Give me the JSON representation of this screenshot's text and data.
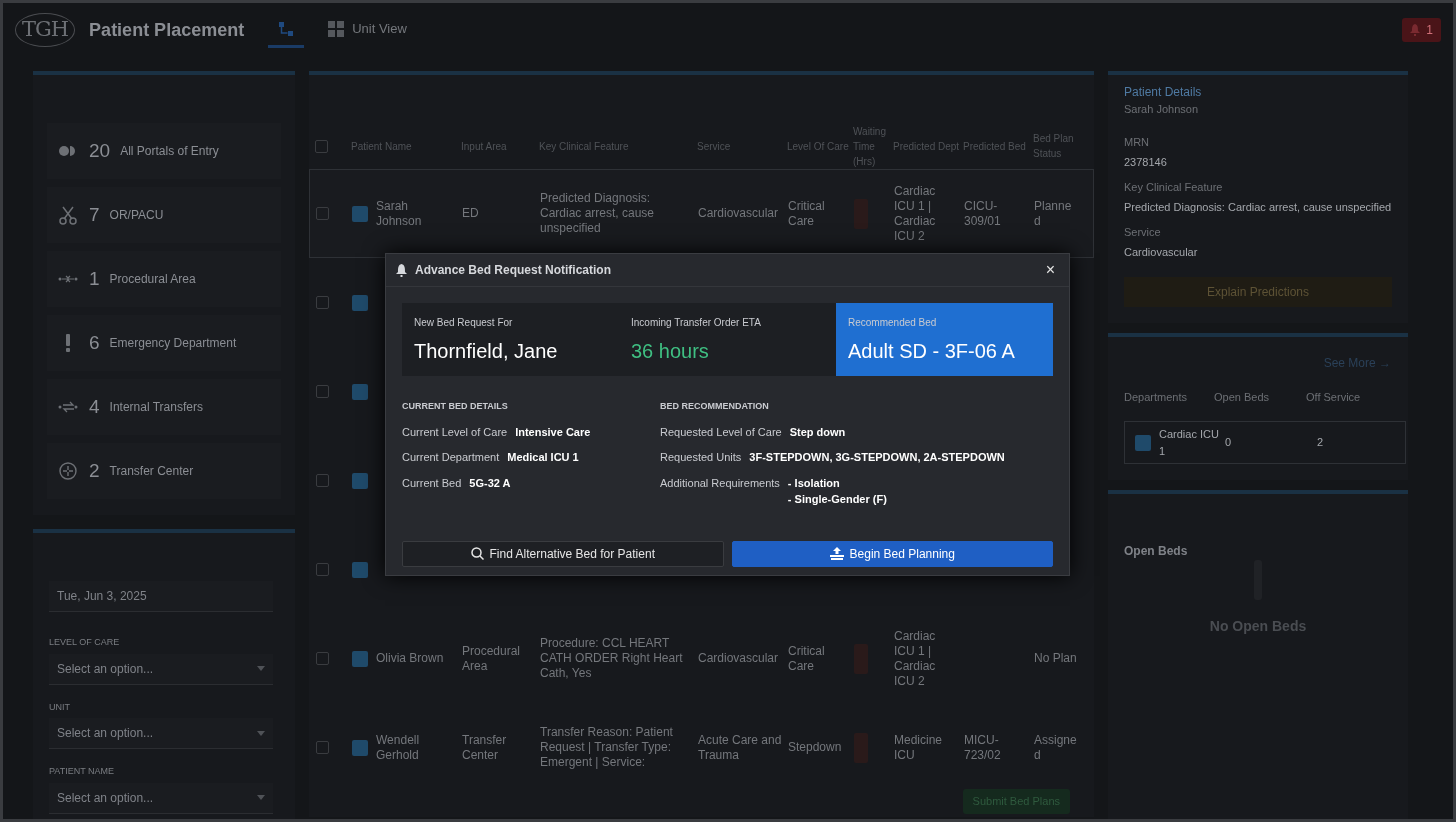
{
  "app": {
    "logo": "TGH",
    "title": "Patient Placement"
  },
  "nav_tabs": [
    {
      "selected": true
    },
    {
      "label": "Unit View",
      "selected": false
    }
  ],
  "notifications": {
    "count": "1"
  },
  "portals": [
    {
      "kind": "toggle",
      "count": "20",
      "label": "All Portals of Entry"
    },
    {
      "kind": "scissors",
      "count": "7",
      "label": "OR/PACU"
    },
    {
      "kind": "procedure",
      "count": "1",
      "label": "Procedural Area"
    },
    {
      "kind": "alert",
      "count": "6",
      "label": "Emergency Department"
    },
    {
      "kind": "transfer",
      "count": "4",
      "label": "Internal Transfers"
    },
    {
      "kind": "target",
      "count": "2",
      "label": "Transfer Center"
    }
  ],
  "filters": {
    "date": "Tue, Jun 3, 2025",
    "selects": [
      {
        "label": "LEVEL OF CARE",
        "placeholder": "Select an option..."
      },
      {
        "label": "UNIT",
        "placeholder": "Select an option..."
      },
      {
        "label": "PATIENT NAME",
        "placeholder": "Select an option..."
      }
    ]
  },
  "table": {
    "header_checked": false,
    "columns": [
      "Patient Name",
      "Input Area",
      "Key Clinical Feature",
      "Service",
      "Level Of Care",
      "Waiting Time (Hrs)",
      "Predicted Dept",
      "Predicted Bed",
      "Bed Plan Status"
    ],
    "rows": [
      {
        "kind": "full",
        "selected": true,
        "checked": false,
        "name": "Sarah Johnson",
        "input_area": "ED",
        "feature": "Predicted Diagnosis: Cardiac arrest, cause unspecified",
        "service": "Cardiovascular",
        "level_of_care": "Critical Care",
        "dept": "Cardiac ICU 1 | Cardiac ICU 2",
        "bed": "CICU-309/01",
        "status": "Planned"
      },
      {
        "kind": "covered",
        "selected": false,
        "checked": false
      },
      {
        "kind": "covered",
        "selected": false,
        "checked": false
      },
      {
        "kind": "covered",
        "selected": false,
        "checked": false
      },
      {
        "kind": "covered",
        "selected": false,
        "checked": false
      },
      {
        "kind": "full",
        "selected": false,
        "checked": false,
        "name": "Olivia Brown",
        "input_area": "Procedural Area",
        "feature": "Procedure: CCL HEART CATH ORDER Right Heart Cath, Yes",
        "service": "Cardiovascular",
        "level_of_care": "Critical Care",
        "dept": "Cardiac ICU 1 | Cardiac ICU 2",
        "status": "No Plan"
      },
      {
        "kind": "full",
        "selected": false,
        "checked": false,
        "name": "Wendell Gerhold",
        "input_area": "Transfer Center",
        "feature": "Transfer Reason: Patient Request | Transfer Type: Emergent | Service:",
        "service": "Acute Care and Trauma",
        "level_of_care": "Stepdown",
        "dept": "Medicine ICU",
        "bed": "MICU-723/02",
        "status": "Assigned"
      }
    ]
  },
  "submit_button": "Submit Bed Plans",
  "patient_details": {
    "title": "Patient Details",
    "name": "Sarah Johnson",
    "fields": [
      {
        "label": "MRN",
        "value": "2378146"
      },
      {
        "label": "Key Clinical Feature",
        "value": "Predicted Diagnosis: Cardiac arrest, cause unspecified"
      },
      {
        "label": "Service",
        "value": "Cardiovascular"
      }
    ],
    "explain_button": "Explain Predictions"
  },
  "departments": {
    "see_more": "See More →",
    "columns": [
      "Departments",
      "Open Beds",
      "Off Service"
    ],
    "rows": [
      {
        "name": "Cardiac ICU 1",
        "open_beds": "0",
        "off_service": "2"
      }
    ]
  },
  "open_beds": {
    "title": "Open Beds",
    "empty": "No Open Beds"
  },
  "modal": {
    "title": "Advance Bed Request Notification",
    "close": "×",
    "stats": [
      {
        "kind": "plain",
        "label": "New Bed Request For",
        "value": "Thornfield, Jane"
      },
      {
        "kind": "eta",
        "label": "Incoming Transfer Order ETA",
        "value": "36 hours"
      },
      {
        "kind": "highlight",
        "label": "Recommended Bed",
        "value": "Adult SD - 3F-06 A"
      }
    ],
    "sections": [
      {
        "heading": "CURRENT BED DETAILS",
        "items": [
          {
            "label": "Current Level of Care",
            "values": [
              "Intensive Care"
            ]
          },
          {
            "label": "Current Department",
            "values": [
              "Medical ICU 1"
            ]
          },
          {
            "label": "Current Bed",
            "values": [
              "5G-32 A"
            ]
          }
        ]
      },
      {
        "heading": "BED RECOMMENDATION",
        "items": [
          {
            "label": "Requested Level of Care",
            "values": [
              "Step down"
            ]
          },
          {
            "label": "Requested Units",
            "values": [
              "3F-STEPDOWN, 3G-STEPDOWN, 2A-STEPDOWN"
            ]
          },
          {
            "label": "Additional Requirements",
            "values": [
              "- Isolation",
              "- Single-Gender (F)"
            ]
          }
        ]
      }
    ],
    "buttons": [
      {
        "kind": "secondary",
        "label": "Find Alternative Bed for Patient"
      },
      {
        "kind": "primary",
        "label": "Begin Bed Planning"
      }
    ]
  }
}
